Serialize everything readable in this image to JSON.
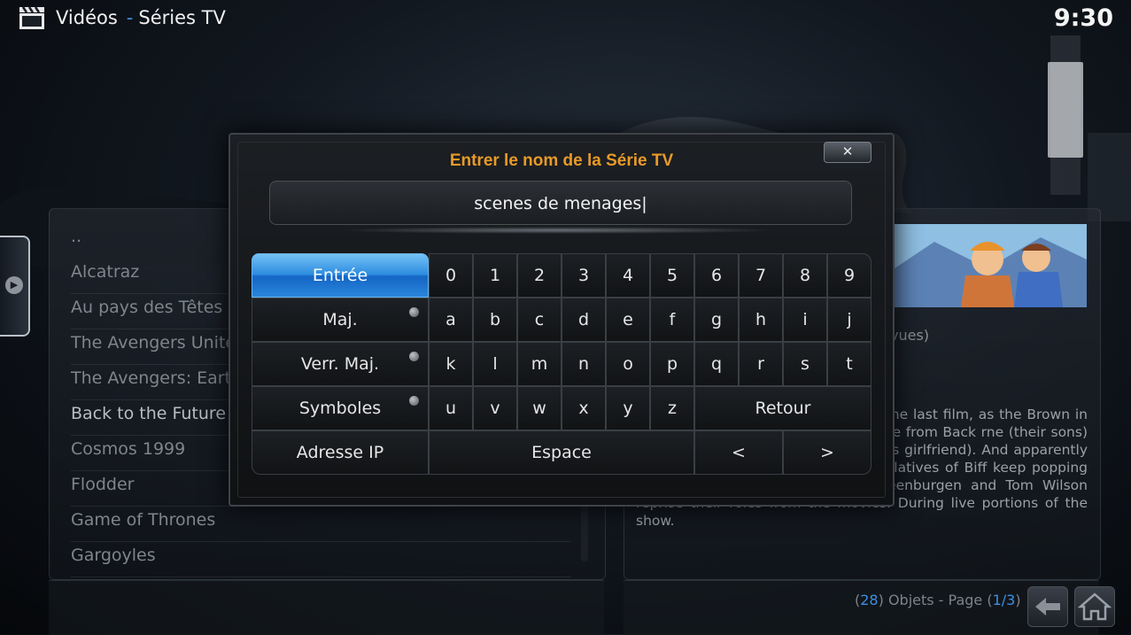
{
  "header": {
    "section": "Vidéos",
    "separator": "-",
    "subsection": "Séries TV",
    "clock": "9:30"
  },
  "series_list": [
    "..",
    "Alcatraz",
    "Au pays des Têtes à",
    "The Avengers United",
    "The Avengers: Earth'",
    "Back to the Future",
    "Cosmos 1999",
    "Flodder",
    "Game of Thrones",
    "Gargoyles"
  ],
  "series_list_focus_index": 5,
  "info": {
    "views": "vues)",
    "synopsis": "to the Future movie trilogy, ents of the last film, as the Brown in their DeLorean time Clara, (Doc's wife from Back rne (their sons) Einstein the dog and Jennifer (Marty's girlfriend). And apparently there's a Tannen in every time as relatives of Biff keep popping up, and creating conflict. Mary Steenburgen and Tom Wilson reprise their roles from the movies. During live portions of the show."
  },
  "footer": {
    "count_open": "(",
    "count": "28",
    "objects_label": ") Objets - Page (",
    "page": "1/3",
    "close_paren": ")"
  },
  "dialog": {
    "heading": "Entrer le nom de la Série TV",
    "input_value": "scenes de menages|",
    "close_symbol": "✕",
    "keys": {
      "enter": "Entrée",
      "shift": "Maj.",
      "caps": "Verr. Maj.",
      "symbols": "Symboles",
      "ip": "Adresse IP",
      "space": "Espace",
      "backspace": "Retour",
      "left": "<",
      "right": ">",
      "row_digits": [
        "0",
        "1",
        "2",
        "3",
        "4",
        "5",
        "6",
        "7",
        "8",
        "9"
      ],
      "row_a": [
        "a",
        "b",
        "c",
        "d",
        "e",
        "f",
        "g",
        "h",
        "i",
        "j"
      ],
      "row_k": [
        "k",
        "l",
        "m",
        "n",
        "o",
        "p",
        "q",
        "r",
        "s",
        "t"
      ],
      "row_u": [
        "u",
        "v",
        "w",
        "x",
        "y",
        "z"
      ]
    }
  },
  "colors": {
    "accent": "#3d8fe0",
    "heading": "#e89a28",
    "enter_key": "#2c8ce0"
  }
}
